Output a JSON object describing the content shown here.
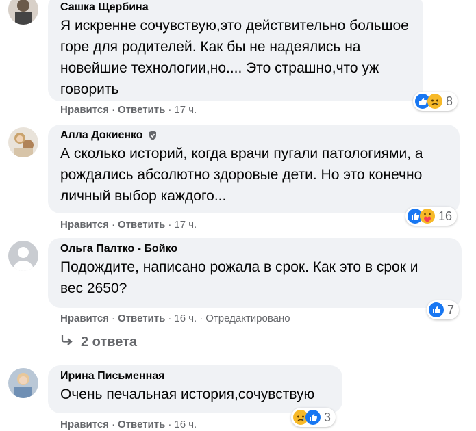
{
  "comments": [
    {
      "author": "Сашка Щербина",
      "lines": [
        "Я искренне сочувствую,это действительно большое",
        "горе для родителей. Как бы не надеялись на",
        "новейшие технологии,но.... Это страшно,что уж",
        "говорить"
      ],
      "like": "Нравится",
      "reply": "Ответить",
      "time": "17 ч.",
      "reaction_count": "8",
      "reactions": [
        "like",
        "sad"
      ]
    },
    {
      "author": "Алла Докиенко",
      "lines": [
        "А сколько историй, когда врачи пугали патологиями, а",
        "рождались абсолютно здоровые дети. Но это конечно",
        "личный выбор каждого..."
      ],
      "like": "Нравится",
      "reply": "Ответить",
      "time": "17 ч.",
      "reaction_count": "16",
      "reactions": [
        "like",
        "care"
      ]
    },
    {
      "author": "Ольга Палтко - Бойко",
      "lines": [
        "Подождите, написано рожала в срок. Как это в срок и",
        "вес 2650?"
      ],
      "like": "Нравится",
      "reply": "Ответить",
      "time": "16 ч.",
      "edited": "Отредактировано",
      "reaction_count": "7",
      "reactions": [
        "like"
      ]
    },
    {
      "author": "Ирина Письменная",
      "lines": [
        "Очень печальная история,сочувствую"
      ],
      "like": "Нравится",
      "reply": "Ответить",
      "time": "16 ч.",
      "reaction_count": "3",
      "reactions": [
        "sad",
        "like"
      ]
    }
  ],
  "replies_link": "2 ответа",
  "colors": {
    "bubble": "#f0f2f5",
    "meta": "#65676b",
    "like_blue": "#1877f2",
    "sad_yellow": "#f7b928"
  },
  "icons": [
    "like-icon",
    "sad-icon",
    "care-icon",
    "reply-arrow-icon",
    "default-avatar-icon",
    "verified-badge-icon"
  ]
}
